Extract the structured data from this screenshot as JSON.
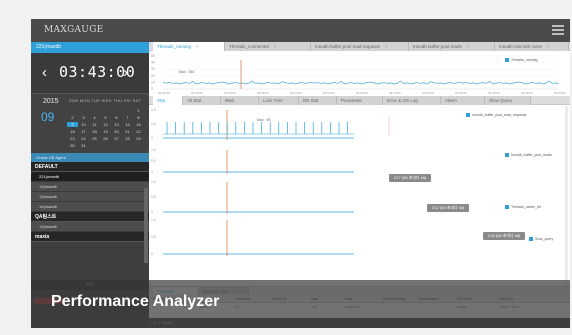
{
  "app": {
    "brand": "MAXGAUGE"
  },
  "left": {
    "instance": "221(maxdb",
    "clock": {
      "prev": "‹",
      "time": "03:43:00",
      "next": "›"
    },
    "calendar": {
      "year": "2015",
      "day": "09",
      "weekdays": "SUN MON TUE WED THU FRI SAT",
      "cells": [
        "",
        "",
        "",
        "",
        "",
        "",
        "1",
        "2",
        "3",
        "4",
        "5",
        "6",
        "7",
        "8",
        "9",
        "10",
        "11",
        "12",
        "13",
        "14",
        "15",
        "16",
        "17",
        "18",
        "19",
        "20",
        "21",
        "22",
        "23",
        "24",
        "25",
        "26",
        "27",
        "28",
        "29",
        "30",
        "31"
      ],
      "selected": "9"
    },
    "agent_header": "Oracle DB Agent",
    "groups": [
      {
        "label": "DEFAULT",
        "items": [
          "221(maxdb",
          "12(maxdb",
          "13(maxdb",
          "14(maxdb"
        ]
      },
      {
        "label": "QA팀스트",
        "items": [
          "12(maxdb"
        ]
      },
      {
        "label": "maxia",
        "items": []
      }
    ],
    "footer": "확인"
  },
  "main": {
    "top_tabs": [
      "Threads_running",
      "Threads_connected",
      "Innodb buffer pool read requests",
      "Innodb buffer pool reads",
      "Innodb row lock curre"
    ],
    "panel_tabs": [
      "Stat",
      "All Stat",
      "Wait",
      "Lock Tree",
      "DB Stat",
      "Parameter",
      "Error & OS Log",
      "Alarm",
      "Slow Query"
    ],
    "grid_tabs": [
      "Threads",
      "Process List"
    ],
    "grid_columns": [
      "ElapsedTime(s)",
      "ID",
      "Thread ID",
      "Event ID",
      "User",
      "Host",
      "Wait Time(ms)",
      "Event Name",
      "DB Name",
      "SQL Text"
    ],
    "grid_row": [
      "0",
      "33009",
      "15",
      "-",
      "root",
      "localhost",
      "-",
      "-",
      "maxia",
      "select * from"
    ],
    "status": "1 / 1 Rows"
  },
  "charts": {
    "legend1": "Threads_running",
    "marker1": "Max : 346",
    "marker2": "Max : 95",
    "legend2": "Innodb_buffer_pool_read_requests",
    "legend3": "Innodb_buffer_pool_reads",
    "legend4": "Threads_cache_hit",
    "legend5": "Slow_query",
    "tip1": "217 (08 초마다 hit)",
    "tip2": "212 (43 초마다 hit)",
    "tip3": "215 (08 초마다 hit)",
    "time_ticks": [
      "03:00:00",
      "03:10:00",
      "03:20:00",
      "03:30:00",
      "03:40:00",
      "03:50:00",
      "04:00:00",
      "04:10:00",
      "04:20:00",
      "04:30:00",
      "04:40:00",
      "04:50:00",
      "05:00:00"
    ],
    "y_top": [
      "50",
      "40",
      "30",
      "20",
      "10",
      "0"
    ],
    "y_small": [
      "1.0",
      "0.5",
      "0"
    ]
  },
  "caption": "Performance Analyzer",
  "colors": {
    "accent": "#2f9fd8",
    "marker": "#e06b3a",
    "dark": "#3e3e3e"
  }
}
